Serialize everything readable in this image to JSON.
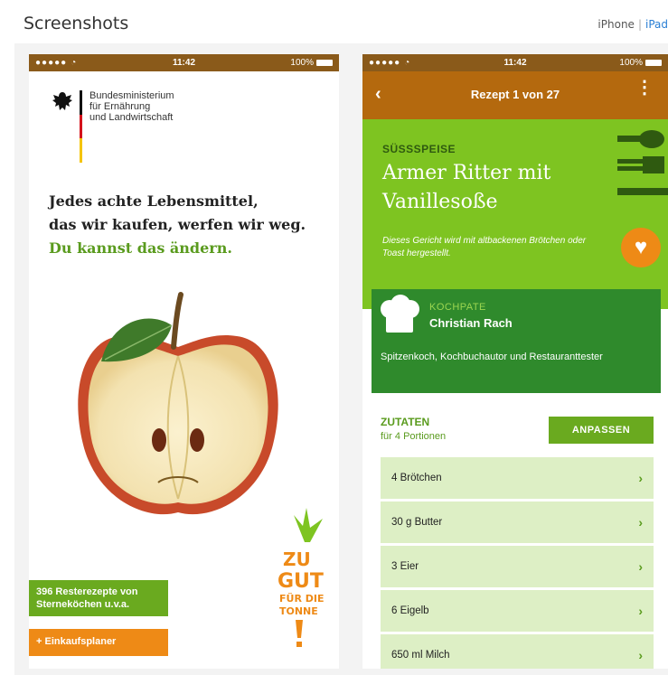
{
  "section": {
    "title": "Screenshots"
  },
  "device_switch": {
    "iphone_label": "iPhone",
    "separator": "|",
    "ipad_label": "iPad"
  },
  "phone1": {
    "status": {
      "signal": "●●●●●",
      "time": "11:42",
      "battery": "100%"
    },
    "ministry": {
      "line1": "Bundesministerium",
      "line2": "für Ernährung",
      "line3": "und Landwirtschaft"
    },
    "headline": {
      "line1": "Jedes achte Lebensmittel,",
      "line2": "das wir kaufen, werfen wir weg.",
      "line3": "Du kannst das ändern."
    },
    "logo_text": "ZU GUT FÜR DIE TONNE!",
    "buttons": {
      "resterezepte": "396 Resterezepte von Sterneköchen u.v.a.",
      "einkaufsplaner": "+ Einkaufsplaner"
    },
    "colors": {
      "green": "#6aaa1f",
      "orange": "#ee8a16"
    }
  },
  "phone2": {
    "status": {
      "signal": "●●●●●",
      "time": "11:42",
      "battery": "100%"
    },
    "nav": {
      "back": "‹",
      "title": "Rezept 1 von 27",
      "more": "⋮"
    },
    "recipe": {
      "category": "SÜSSSPEISE",
      "title": "Armer Ritter mit Vanillesoße",
      "description": "Dieses Gericht wird mit altbackenen Brötchen oder Toast hergestellt."
    },
    "kochpate": {
      "label": "KOCHPATE",
      "name": "Christian Rach",
      "bio": "Spitzenkoch, Kochbuchautor und Restauranttester"
    },
    "ingredients_header": {
      "label": "ZUTATEN",
      "portions": "für 4 Portionen",
      "adjust_button": "ANPASSEN"
    },
    "ingredients": [
      {
        "label": "4 Brötchen"
      },
      {
        "label": "30 g Butter"
      },
      {
        "label": "3 Eier"
      },
      {
        "label": "6 Eigelb"
      },
      {
        "label": "650 ml Milch"
      }
    ],
    "colors": {
      "header_green": "#7ec421",
      "nav_brown": "#b4690e",
      "kochpate_green": "#2f8a2c",
      "heart_orange": "#ee8a16"
    }
  }
}
